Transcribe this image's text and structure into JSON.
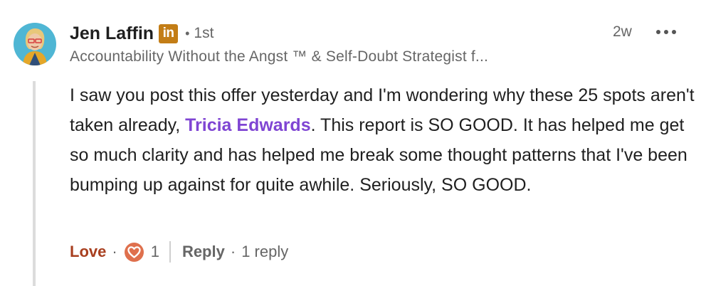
{
  "comment": {
    "author": {
      "name": "Jen Laffin",
      "linkedin_badge": "in",
      "degree_separator": "•",
      "connection_degree": "1st",
      "headline": "Accountability Without the Angst ™ & Self-Doubt Strategist f..."
    },
    "timestamp": "2w",
    "menu_icon": "more-horizontal-icon",
    "body": {
      "text_before_mention": "I saw you post this offer yesterday and I'm wondering why these 25 spots aren't taken already, ",
      "mention": "Tricia Edwards",
      "text_after_mention": ". This report is SO GOOD. It has helped me get so much clarity and has helped me break some thought patterns that I've been bumping up against for quite awhile. Seriously, SO GOOD."
    },
    "actions": {
      "reaction_label": "Love",
      "separator": "·",
      "reaction_icon": "love-heart-icon",
      "reaction_count": "1",
      "reply_label": "Reply",
      "reply_count": "1 reply"
    }
  },
  "colors": {
    "mention": "#7f45d3",
    "love": "#a83f1f",
    "love_icon_bg": "#df704d",
    "linkedin_badge_bg": "#c37d16",
    "muted_text": "#666666",
    "thread_line": "#dcdcdc"
  }
}
